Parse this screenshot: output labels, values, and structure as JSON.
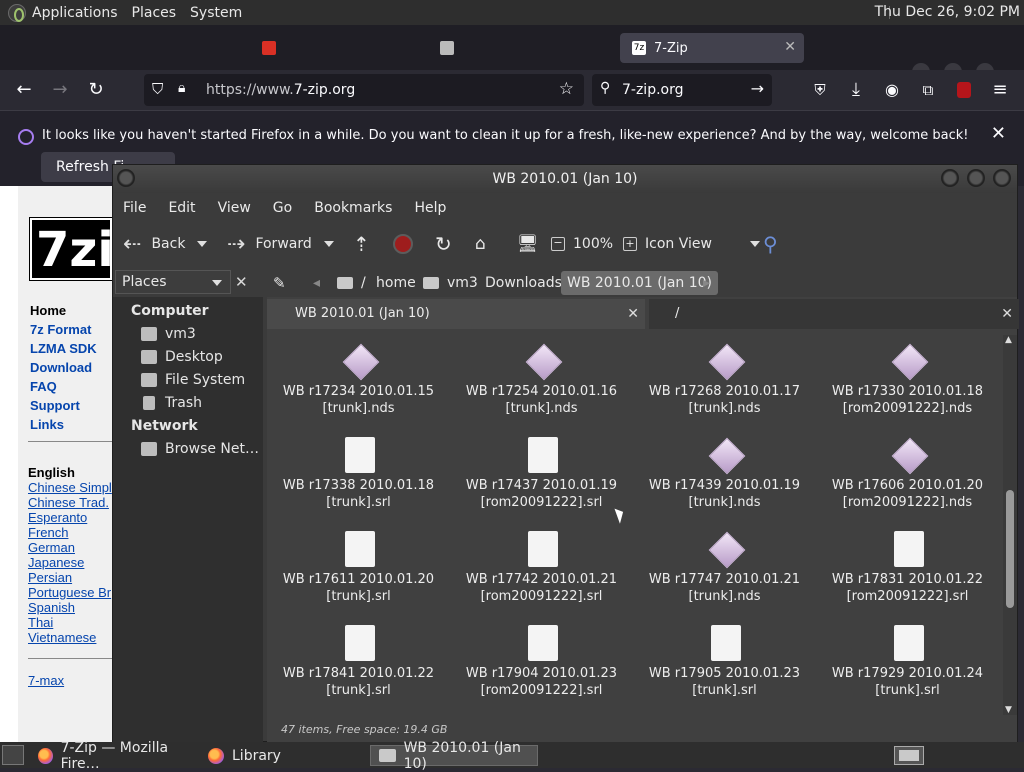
{
  "topbar": {
    "menus": [
      "Applications",
      "Places",
      "System"
    ],
    "clock": "Thu Dec 26,  9:02 PM"
  },
  "firefox": {
    "tabs": [
      {
        "label": "7-Zip"
      }
    ],
    "url": {
      "prefix": "https://www.",
      "domain": "7-zip.org"
    },
    "search": "7-zip.org",
    "notification": {
      "message": "It looks like you haven't started Firefox in a while. Do you want to clean it up for a fresh, like-new experience? And by the way, welcome back!",
      "button": "Refresh Fi"
    }
  },
  "website": {
    "logo": "7zi",
    "nav": [
      "Home",
      "7z Format",
      "LZMA SDK",
      "Download",
      "FAQ",
      "Support",
      "Links"
    ],
    "lang_heading": "English",
    "languages": [
      "Chinese Simpl",
      "Chinese Trad.",
      "Esperanto",
      "French",
      "German",
      "Japanese",
      "Persian",
      "Portuguese Br",
      "Spanish",
      "Thai",
      "Vietnamese"
    ],
    "footer_link": "7-max"
  },
  "filemanager": {
    "title": "WB 2010.01 (Jan 10)",
    "menu": [
      "File",
      "Edit",
      "View",
      "Go",
      "Bookmarks",
      "Help"
    ],
    "toolbar": {
      "back": "Back",
      "forward": "Forward",
      "zoom": "100%",
      "view": "Icon View"
    },
    "places_label": "Places",
    "breadcrumb": [
      "/",
      "home",
      "vm3",
      "Downloads",
      "WB 2010.01 (Jan 10)"
    ],
    "sidebar": {
      "computer_heading": "Computer",
      "computer_items": [
        "vm3",
        "Desktop",
        "File System",
        "Trash"
      ],
      "network_heading": "Network",
      "network_items": [
        "Browse Net…"
      ]
    },
    "tabs": [
      "WB 2010.01 (Jan 10)",
      "/"
    ],
    "files": [
      {
        "line1": "WB r17234 2010.01.15",
        "line2": "[trunk].nds",
        "type": "nds"
      },
      {
        "line1": "WB r17254 2010.01.16",
        "line2": "[trunk].nds",
        "type": "nds"
      },
      {
        "line1": "WB r17268 2010.01.17",
        "line2": "[trunk].nds",
        "type": "nds"
      },
      {
        "line1": "WB r17330 2010.01.18",
        "line2": "[rom20091222].nds",
        "type": "nds"
      },
      {
        "line1": "WB r17338 2010.01.18",
        "line2": "[trunk].srl",
        "type": "srl"
      },
      {
        "line1": "WB r17437 2010.01.19",
        "line2": "[rom20091222].srl",
        "type": "srl"
      },
      {
        "line1": "WB r17439 2010.01.19",
        "line2": "[trunk].nds",
        "type": "nds"
      },
      {
        "line1": "WB r17606 2010.01.20",
        "line2": "[rom20091222].nds",
        "type": "nds"
      },
      {
        "line1": "WB r17611 2010.01.20",
        "line2": "[trunk].srl",
        "type": "srl"
      },
      {
        "line1": "WB r17742 2010.01.21",
        "line2": "[rom20091222].srl",
        "type": "srl"
      },
      {
        "line1": "WB r17747 2010.01.21",
        "line2": "[trunk].nds",
        "type": "nds"
      },
      {
        "line1": "WB r17831 2010.01.22",
        "line2": "[rom20091222].srl",
        "type": "srl"
      },
      {
        "line1": "WB r17841 2010.01.22",
        "line2": "[trunk].srl",
        "type": "srl"
      },
      {
        "line1": "WB r17904 2010.01.23",
        "line2": "[rom20091222].srl",
        "type": "srl"
      },
      {
        "line1": "WB r17905 2010.01.23",
        "line2": "[trunk].srl",
        "type": "srl"
      },
      {
        "line1": "WB r17929 2010.01.24",
        "line2": "[trunk].srl",
        "type": "srl"
      }
    ],
    "status": "47 items, Free space: 19.4 GB"
  },
  "taskbar": {
    "items": [
      "7-Zip — Mozilla Fire…",
      "Library",
      "WB 2010.01 (Jan 10)"
    ]
  }
}
